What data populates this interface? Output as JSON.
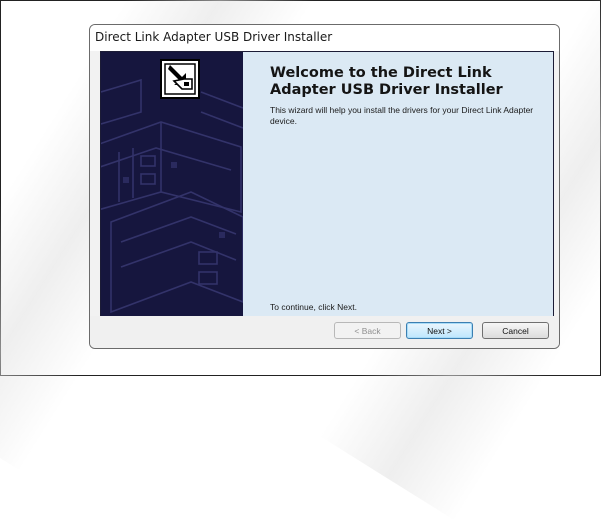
{
  "window": {
    "title": "Direct Link Adapter USB Driver Installer"
  },
  "welcome": {
    "heading": "Welcome to the Direct Link Adapter USB Driver Installer",
    "description": "This wizard will help you install the drivers for your Direct Link Adapter device.",
    "continue_hint": "To continue, click Next."
  },
  "buttons": {
    "back": "< Back",
    "next": "Next >",
    "cancel": "Cancel"
  },
  "colors": {
    "side_panel": "#16163e",
    "content_bg": "#dbe9f4",
    "default_button_border": "#3c7fb1"
  },
  "icons": {
    "installer_logo": "usb-device-icon"
  }
}
